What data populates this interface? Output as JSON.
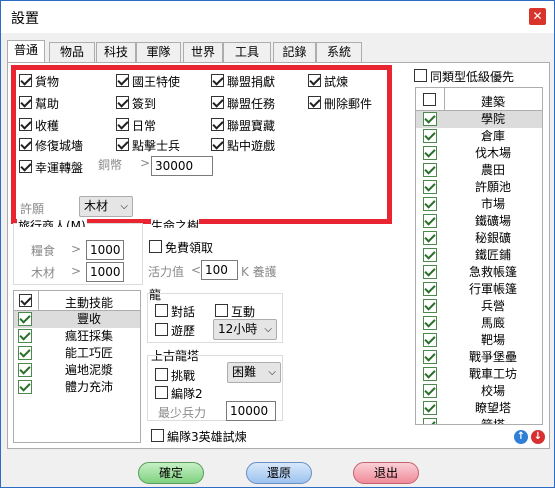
{
  "window": {
    "title": "設置",
    "close_glyph": "✕"
  },
  "tabs": [
    "普通",
    "物品",
    "科技",
    "軍隊",
    "世界",
    "工具",
    "記錄",
    "系統"
  ],
  "options": [
    {
      "label": "貨物",
      "checked": true
    },
    {
      "label": "國王特使",
      "checked": true
    },
    {
      "label": "聯盟捐獻",
      "checked": true
    },
    {
      "label": "試煉",
      "checked": true
    },
    {
      "label": "幫助",
      "checked": true
    },
    {
      "label": "簽到",
      "checked": true
    },
    {
      "label": "聯盟任務",
      "checked": true
    },
    {
      "label": "刪除郵件",
      "checked": true
    },
    {
      "label": "收穫",
      "checked": true
    },
    {
      "label": "日常",
      "checked": true
    },
    {
      "label": "聯盟寶藏",
      "checked": true
    },
    {
      "label": "修復城墻",
      "checked": true
    },
    {
      "label": "點擊士兵",
      "checked": true
    },
    {
      "label": "點中遊戲",
      "checked": true
    },
    {
      "label": "幸運轉盤",
      "checked": true
    }
  ],
  "copper": {
    "label": "銅幣",
    "op": ">",
    "value": "30000"
  },
  "wish": {
    "label": "許願",
    "value": "木材",
    "arrow": "⌵"
  },
  "merchant": {
    "title": "旅行商人(M)",
    "food_label": "糧食",
    "food_op": ">",
    "food_value": "1000",
    "wood_label": "木材",
    "wood_op": ">",
    "wood_value": "1000"
  },
  "life": {
    "title": "生命之樹",
    "free_label": "免費領取",
    "free_checked": false,
    "vit_label": "活力值",
    "vit_op": "<",
    "vit_value": "100",
    "vit_suffix": "K 養護"
  },
  "skills": {
    "header": "主動技能",
    "header_checked": true,
    "items": [
      {
        "label": "豐收",
        "checked": true,
        "selected": true
      },
      {
        "label": "瘋狂採集",
        "checked": true
      },
      {
        "label": "能工巧匠",
        "checked": true
      },
      {
        "label": "遍地泥漿",
        "checked": true
      },
      {
        "label": "體力充沛",
        "checked": true
      }
    ]
  },
  "dragon": {
    "title": "龍",
    "talk": "對話",
    "interact": "互動",
    "travel": "遊歷",
    "travel_time": "12小時",
    "arrow": "⌵"
  },
  "ancient": {
    "title": "上古龍塔",
    "challenge": "挑戰",
    "difficulty": "困難",
    "arrow": "⌵",
    "formation": "編隊2",
    "min_troops_label": "最少兵力",
    "min_troops_value": "10000"
  },
  "formation3": {
    "label": "編隊3英雄試煉",
    "checked": false
  },
  "low_priority": {
    "label": "同類型低級優先",
    "checked": false
  },
  "buildings": {
    "header": "建築",
    "header_checked": false,
    "items": [
      "學院",
      "倉庫",
      "伐木場",
      "農田",
      "許願池",
      "市場",
      "鐵礦場",
      "秘銀礦",
      "鐵匠鋪",
      "急救帳篷",
      "行軍帳篷",
      "兵營",
      "馬廄",
      "靶場",
      "戰爭堡壘",
      "戰車工坊",
      "校場",
      "瞭望塔",
      "箭塔"
    ]
  },
  "scroll": {
    "up": "↑",
    "down": "↓"
  },
  "buttons": {
    "ok": "確定",
    "reset": "還原",
    "exit": "退出"
  },
  "colors": {
    "highlight": "#e82530",
    "accent": "#2b6cc4"
  }
}
